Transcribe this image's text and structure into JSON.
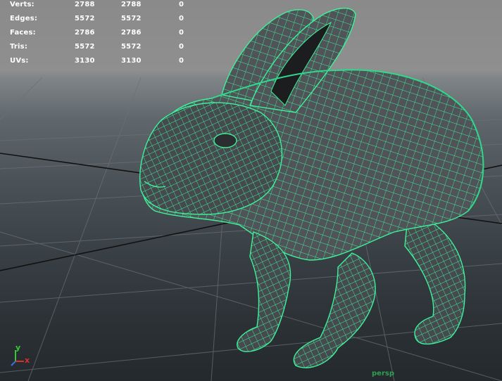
{
  "hud": {
    "rows": [
      {
        "label": "Verts:",
        "v1": "2788",
        "v2": "2788",
        "v3": "0"
      },
      {
        "label": "Edges:",
        "v1": "5572",
        "v2": "5572",
        "v3": "0"
      },
      {
        "label": "Faces:",
        "v1": "2786",
        "v2": "2786",
        "v3": "0"
      },
      {
        "label": "Tris:",
        "v1": "5572",
        "v2": "5572",
        "v3": "0"
      },
      {
        "label": "UVs:",
        "v1": "3130",
        "v2": "3130",
        "v3": "0"
      }
    ]
  },
  "camera": {
    "name": "persp"
  },
  "axes": {
    "y": "y",
    "x": "x"
  },
  "colors": {
    "wireframe": "#3df29a",
    "mesh_fill": "#4e5155",
    "hud_text": "#ffffff",
    "axis_x": "#d83030",
    "axis_y": "#37c837",
    "axis_z": "#3a6fe0",
    "camera_label": "#2ea052"
  }
}
